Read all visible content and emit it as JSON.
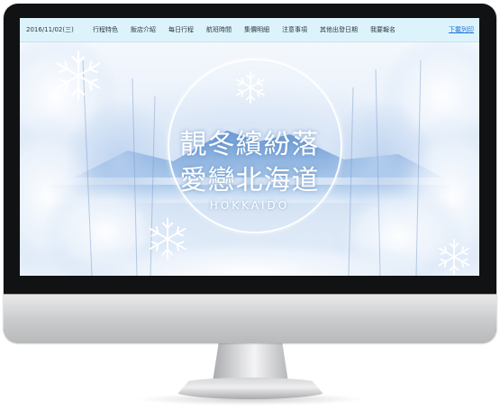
{
  "nav": {
    "date": "2016/11/02(三)",
    "items": [
      "行程特色",
      "飯店介紹",
      "每日行程",
      "航班時間",
      "集價明細",
      "注意事項",
      "其他出發日期",
      "我要報名"
    ],
    "download": "下載列印"
  },
  "hero": {
    "title_line1": "靚冬繽紛落",
    "title_line2": "愛戀北海道",
    "subtitle": "HOKKAIDO"
  },
  "colors": {
    "nav_bg": "#ddf3fb",
    "link": "#1a73d9",
    "bezel": "#111214"
  }
}
